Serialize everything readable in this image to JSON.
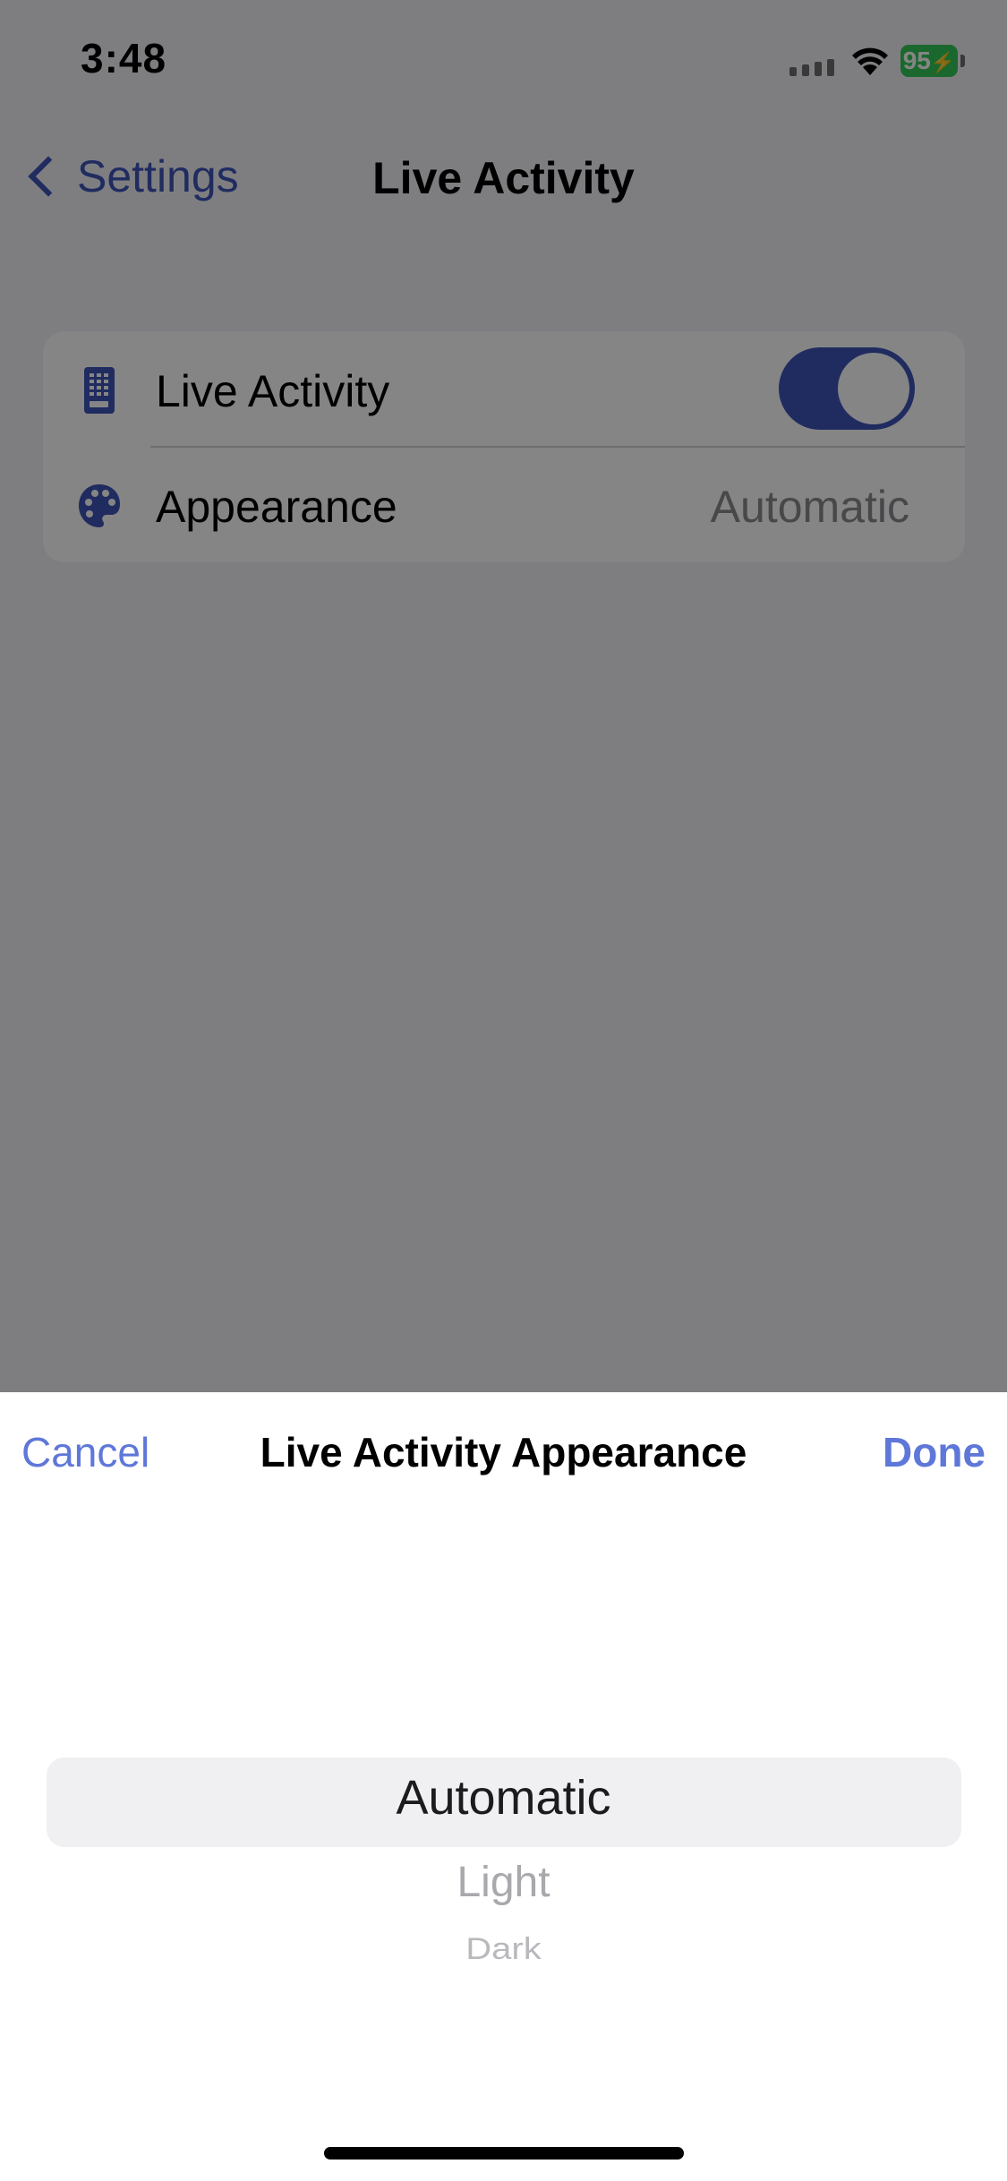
{
  "status_bar": {
    "time": "3:48",
    "battery": "95"
  },
  "nav": {
    "back_label": "Settings",
    "title": "Live Activity"
  },
  "settings": {
    "rows": [
      {
        "label": "Live Activity",
        "icon": "phone-icon",
        "toggle_on": true
      },
      {
        "label": "Appearance",
        "icon": "palette-icon",
        "value": "Automatic"
      }
    ]
  },
  "sheet": {
    "cancel_label": "Cancel",
    "title": "Live Activity Appearance",
    "done_label": "Done",
    "options": [
      "Automatic",
      "Light",
      "Dark"
    ],
    "selected": "Automatic"
  },
  "colors": {
    "accent": "#3e55b8",
    "sheet_accent": "#5e77d8",
    "battery": "#34c759"
  }
}
